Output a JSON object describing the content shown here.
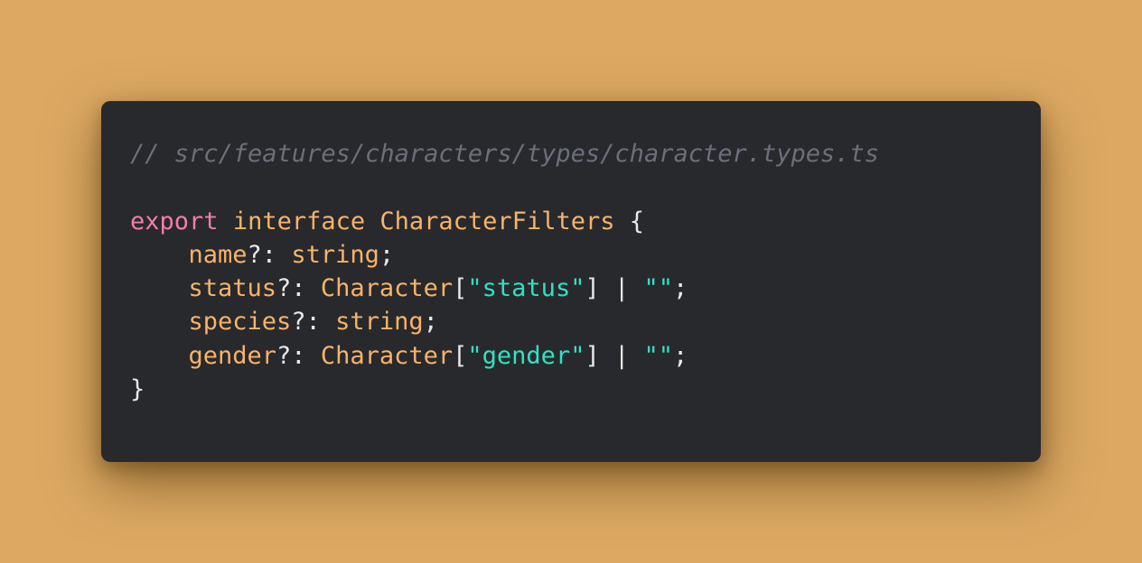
{
  "code": {
    "comment": "// src/features/characters/types/character.types.ts",
    "line1": {
      "export_kw": "export",
      "interface_kw": "interface",
      "name": "CharacterFilters",
      "open_brace": "{"
    },
    "line2": {
      "prop": "name",
      "opt": "?: ",
      "type": "string",
      "end": ";"
    },
    "line3": {
      "prop": "status",
      "opt": "?: ",
      "type": "Character",
      "lbr": "[",
      "key": "\"status\"",
      "rbr": "]",
      "union": " | ",
      "empty": "\"\"",
      "end": ";"
    },
    "line4": {
      "prop": "species",
      "opt": "?: ",
      "type": "string",
      "end": ";"
    },
    "line5": {
      "prop": "gender",
      "opt": "?: ",
      "type": "Character",
      "lbr": "[",
      "key": "\"gender\"",
      "rbr": "]",
      "union": " | ",
      "empty": "\"\"",
      "end": ";"
    },
    "close_brace": "}"
  },
  "colors": {
    "background": "#dba962",
    "window": "#28292c",
    "comment": "#6b6f7a",
    "keyword": "#f47ca9",
    "identifier": "#f8b36a",
    "string": "#2fe2c5",
    "punctuation": "#e8e8e8"
  }
}
